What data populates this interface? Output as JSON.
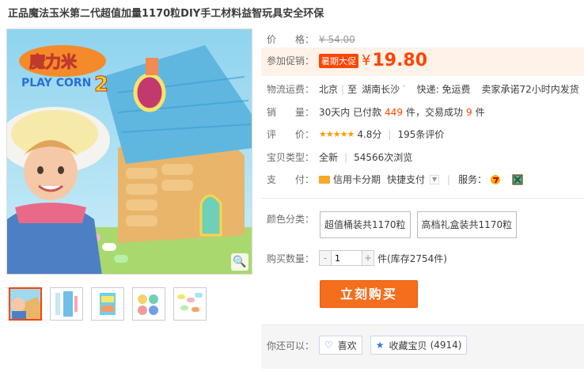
{
  "title": "正品魔法玉米第二代超值加量1170粒DIY手工材料益智玩具安全环保",
  "price": {
    "label": "价　　格：",
    "original": "¥ 54.00"
  },
  "promo": {
    "label": "参加促销：",
    "tag": "暑期大促",
    "yen": "¥",
    "price": "19.80"
  },
  "shipping": {
    "label": "物流运费：",
    "from": "北京",
    "sep": "至",
    "to": "湖南长沙",
    "fee": "快递: 免运费",
    "promise": "卖家承诺72小时内发货"
  },
  "sales": {
    "label": "销　　量：",
    "prefix": "30天内 已付款",
    "paid": "449",
    "mid": "件，交易成功",
    "success": "9",
    "suffix": "件"
  },
  "rating": {
    "label": "评　　价：",
    "stars": "★★★★★",
    "score": "4.8分",
    "reviews": "195条评价"
  },
  "type": {
    "label": "宝贝类型：",
    "value": "全新",
    "views": "54566次浏览"
  },
  "payment": {
    "label": "支　　付：",
    "credit": "信用卡分期",
    "quick": "快捷支付",
    "service_label": "服务："
  },
  "sku": {
    "label": "颜色分类：",
    "options": [
      "超值桶装共1170粒",
      "高档礼盒装共1170粒"
    ]
  },
  "quantity": {
    "label": "购买数量：",
    "value": "1",
    "minus": "-",
    "plus": "+",
    "unit": "件",
    "stock": "(库存2754件)"
  },
  "buy_button": "立刻购买",
  "share": {
    "label": "你还可以：",
    "like": "喜欢",
    "favorite": "收藏宝贝",
    "fav_count": "(4914)"
  },
  "image_text": {
    "logo_top": "魔力米",
    "logo_sub": "PLAY CORN",
    "logo_num": "2"
  },
  "colors": {
    "accent": "#ff4400",
    "buy": "#f46e1e"
  }
}
